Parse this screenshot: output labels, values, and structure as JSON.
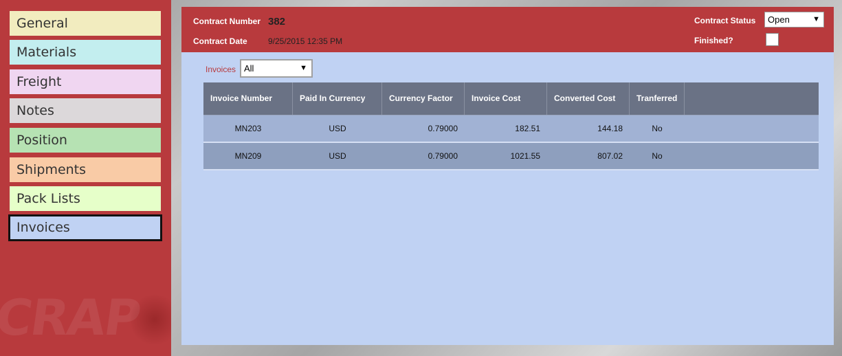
{
  "sidebar": {
    "items": [
      {
        "label": "General",
        "color": "#f2ecbf"
      },
      {
        "label": "Materials",
        "color": "#c3eeef"
      },
      {
        "label": "Freight",
        "color": "#f0d6f1"
      },
      {
        "label": "Notes",
        "color": "#dcd8da"
      },
      {
        "label": "Position",
        "color": "#b6e2b3"
      },
      {
        "label": "Shipments",
        "color": "#f9cba6"
      },
      {
        "label": "Pack Lists",
        "color": "#e6ffc9"
      },
      {
        "label": "Invoices",
        "color": "#c0d2f3"
      }
    ],
    "active": "Invoices",
    "watermark": "CRAP"
  },
  "header": {
    "contract_number_label": "Contract Number",
    "contract_number": "382",
    "contract_date_label": "Contract Date",
    "contract_date": "9/25/2015 12:35 PM",
    "status_label": "Contract Status",
    "status_value": "Open",
    "finished_label": "Finished?"
  },
  "filter": {
    "label": "Invoices",
    "value": "All"
  },
  "grid": {
    "columns": [
      "Invoice Number",
      "Paid In Currency",
      "Currency Factor",
      "Invoice Cost",
      "Converted Cost",
      "Tranferred"
    ],
    "rows": [
      [
        "MN203",
        "USD",
        "0.79000",
        "182.51",
        "144.18",
        "No"
      ],
      [
        "MN209",
        "USD",
        "0.79000",
        "1021.55",
        "807.02",
        "No"
      ]
    ]
  },
  "colors": {
    "accent": "#b83a3d",
    "panel": "#c0d2f3",
    "grid_header": "#6a7285"
  }
}
